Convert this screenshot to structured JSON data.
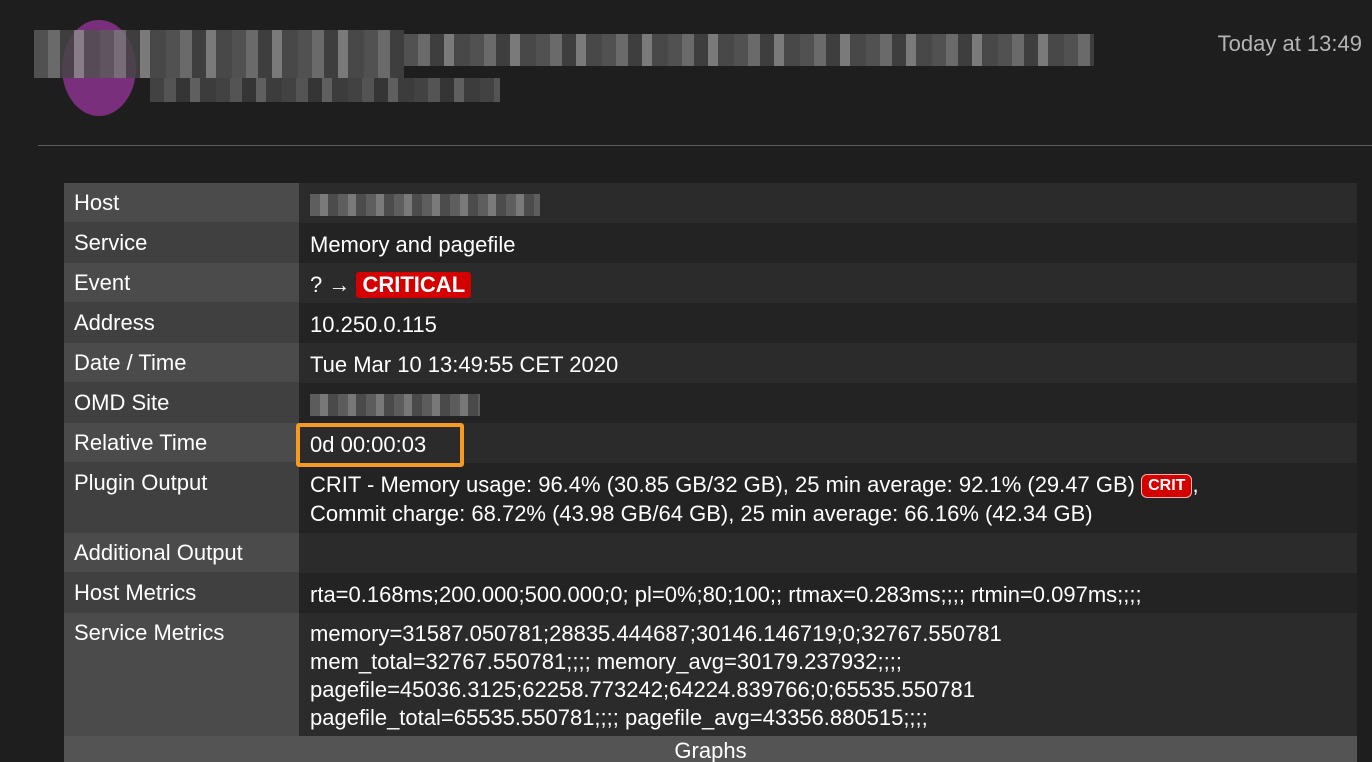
{
  "header": {
    "timestamp": "Today at 13:49"
  },
  "rows": {
    "host": {
      "label": "Host",
      "value": ""
    },
    "service": {
      "label": "Service",
      "value": "Memory and pagefile"
    },
    "event": {
      "label": "Event",
      "from": "? →",
      "state": "CRITICAL"
    },
    "address": {
      "label": "Address",
      "value": "10.250.0.115"
    },
    "datetime": {
      "label": "Date / Time",
      "value": "Tue Mar 10 13:49:55 CET 2020"
    },
    "omd_site": {
      "label": "OMD Site",
      "value": ""
    },
    "relative_time": {
      "label": "Relative Time",
      "value": "0d 00:00:03"
    },
    "plugin_output": {
      "label": "Plugin Output",
      "line1": "CRIT - Memory usage: 96.4% (30.85 GB/32 GB), 25 min average: 92.1% (29.47 GB)",
      "badge": "CRIT",
      "line1_tail": ",",
      "line2": "Commit charge: 68.72% (43.98 GB/64 GB), 25 min average: 66.16% (42.34 GB)"
    },
    "additional_output": {
      "label": "Additional Output",
      "value": ""
    },
    "host_metrics": {
      "label": "Host Metrics",
      "value": "rta=0.168ms;200.000;500.000;0; pl=0%;80;100;; rtmax=0.283ms;;;; rtmin=0.097ms;;;;"
    },
    "service_metrics": {
      "label": "Service Metrics",
      "lines": [
        "memory=31587.050781;28835.444687;30146.146719;0;32767.550781",
        "mem_total=32767.550781;;;; memory_avg=30179.237932;;;;",
        "pagefile=45036.3125;62258.773242;64224.839766;0;65535.550781",
        "pagefile_total=65535.550781;;;; pagefile_avg=43356.880515;;;;"
      ]
    }
  },
  "graphs": {
    "label": "Graphs"
  },
  "colors": {
    "critical": "#d40000",
    "highlight": "#f59a23",
    "avatar": "#7a2f7c"
  }
}
